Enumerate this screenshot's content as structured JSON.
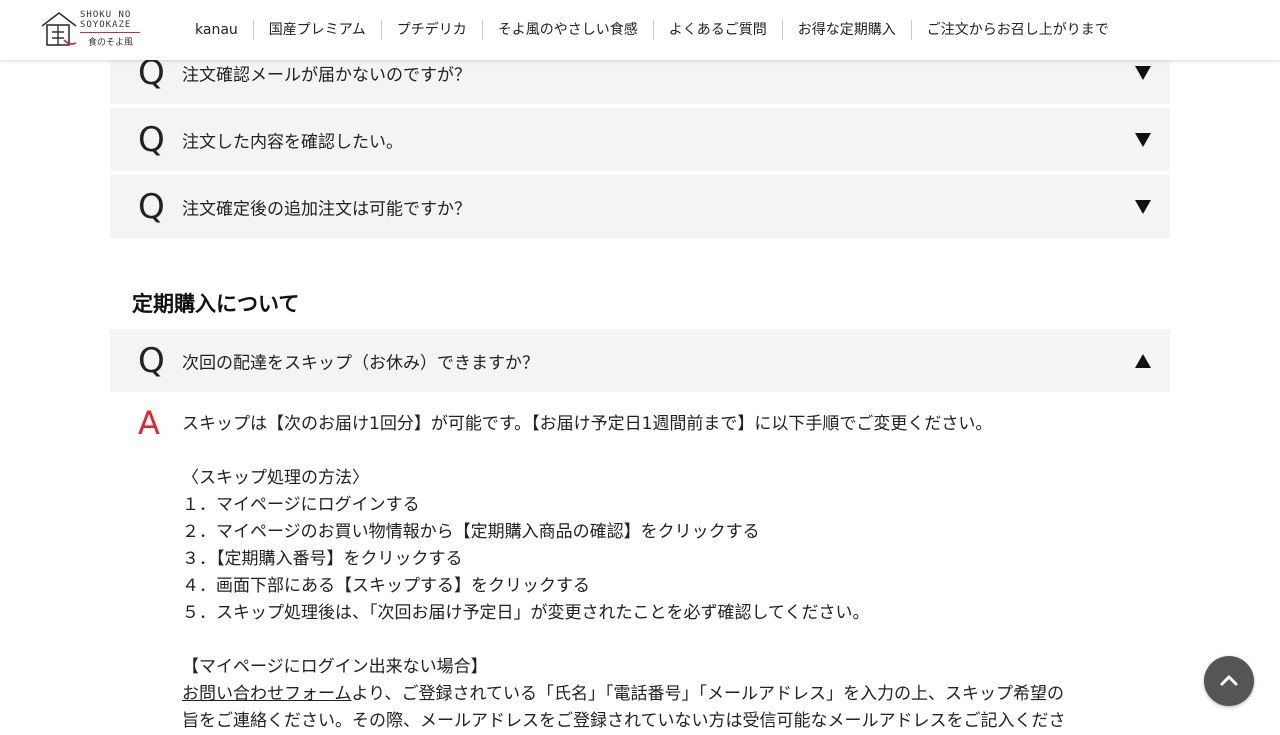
{
  "header": {
    "logo": {
      "line1": "SHOKU NO",
      "line2": "SOYOKAZE",
      "line3": "食のそよ風"
    },
    "nav": [
      "kanau",
      "国産プレミアム",
      "プチデリカ",
      "そよ風のやさしい食感",
      "よくあるご質問",
      "お得な定期購入",
      "ご注文からお召し上がりまで"
    ]
  },
  "faq_top": [
    {
      "q": "Q",
      "text": "注文確認メールが届かないのですが？",
      "state": "collapsed"
    },
    {
      "q": "Q",
      "text": "注文した内容を確認したい。",
      "state": "collapsed"
    },
    {
      "q": "Q",
      "text": "注文確定後の追加注文は可能ですか？",
      "state": "collapsed"
    }
  ],
  "section": {
    "title": "定期購入について",
    "item": {
      "q": "Q",
      "text": "次回の配達をスキップ（お休み）できますか？",
      "state": "expanded"
    },
    "answer": {
      "a": "A",
      "lines": [
        "スキップは【次のお届け1回分】が可能です。【お届け予定日1週間前まで】に以下手順でご変更ください。",
        "",
        "〈スキップ処理の方法〉",
        "１．マイページにログインする",
        "２．マイページのお買い物情報から【定期購入商品の確認】をクリックする",
        "３．【定期購入番号】をクリックする",
        "４．画面下部にある【スキップする】をクリックする",
        "５．スキップ処理後は、「次回お届け予定日」が変更されたことを必ず確認してください。",
        "",
        "【マイページにログイン出来ない場合】"
      ],
      "link_text": "お問い合わせフォーム",
      "link_after": "より、ご登録されている「氏名」「電話番号」「メールアドレス」を入力の上、スキップ希望の",
      "last_line": "旨をご連絡ください。その際、メールアドレスをご登録されていない方は受信可能なメールアドレスをご記入くださ"
    }
  },
  "back_to_top_icon": "chevron-up-icon",
  "colors": {
    "accent": "#e8232c",
    "faq_bg": "#f4f4f4",
    "top_button": "#555555"
  }
}
